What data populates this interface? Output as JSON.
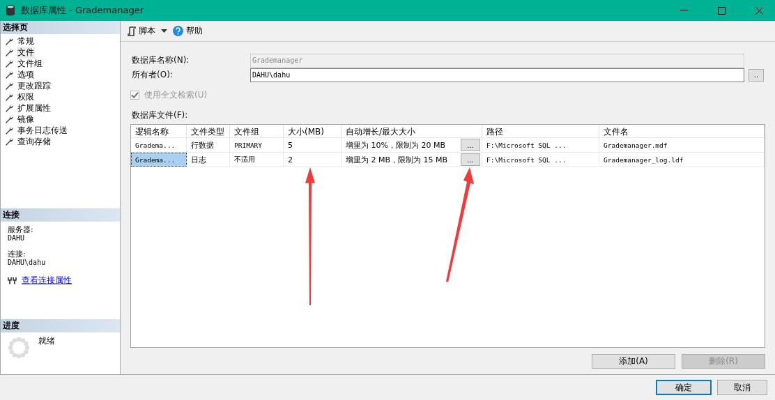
{
  "window": {
    "title": "数据库属性 - Grademanager"
  },
  "sidebar": {
    "header": "选择页",
    "items": [
      {
        "label": "常规",
        "selected": false
      },
      {
        "label": "文件",
        "selected": true
      },
      {
        "label": "文件组",
        "selected": false
      },
      {
        "label": "选项",
        "selected": false
      },
      {
        "label": "更改跟踪",
        "selected": false
      },
      {
        "label": "权限",
        "selected": false
      },
      {
        "label": "扩展属性",
        "selected": false
      },
      {
        "label": "镜像",
        "selected": false
      },
      {
        "label": "事务日志传送",
        "selected": false
      },
      {
        "label": "查询存储",
        "selected": false
      }
    ]
  },
  "connection": {
    "header": "连接",
    "server_label": "服务器:",
    "server": "DAHU",
    "connection_label": "连接:",
    "connection": "DAHU\\dahu",
    "link": "查看连接属性"
  },
  "progress": {
    "header": "进度",
    "status": "就绪"
  },
  "toolbar": {
    "script": "脚本",
    "help": "帮助"
  },
  "form": {
    "name_label": "数据库名称(N):",
    "name_value": "Grademanager",
    "owner_label": "所有者(O):",
    "owner_value": "DAHU\\dahu",
    "browse": "..",
    "fulltext": {
      "label": "使用全文检索(U)",
      "checked": true,
      "disabled": true
    },
    "files_label": "数据库文件(F):"
  },
  "table": {
    "columns": [
      "逻辑名称",
      "文件类型",
      "文件组",
      "大小(MB)",
      "自动增长/最大大小",
      "路径",
      "文件名"
    ],
    "rows": [
      {
        "cells": [
          "Gradema...",
          "行数据",
          "PRIMARY",
          "5",
          "增里为 10%，限制为 20 MB",
          "F:\\Microsoft SQL ...",
          "Grademanager.mdf"
        ],
        "button": "...",
        "selected": false
      },
      {
        "cells": [
          "Gradema...",
          "日志",
          "不适用",
          "2",
          "增里为 2 MB，限制为 15 MB",
          "F:\\Microsoft SQL ...",
          "Grademanager_log.ldf"
        ],
        "button": "...",
        "selected": true
      }
    ]
  },
  "actions": [
    {
      "label": "添加(A)",
      "disabled": false
    },
    {
      "label": "删除(R)",
      "disabled": true
    }
  ],
  "footer": [
    {
      "label": "确定",
      "selected": true
    },
    {
      "label": "取消",
      "selected": false
    }
  ]
}
